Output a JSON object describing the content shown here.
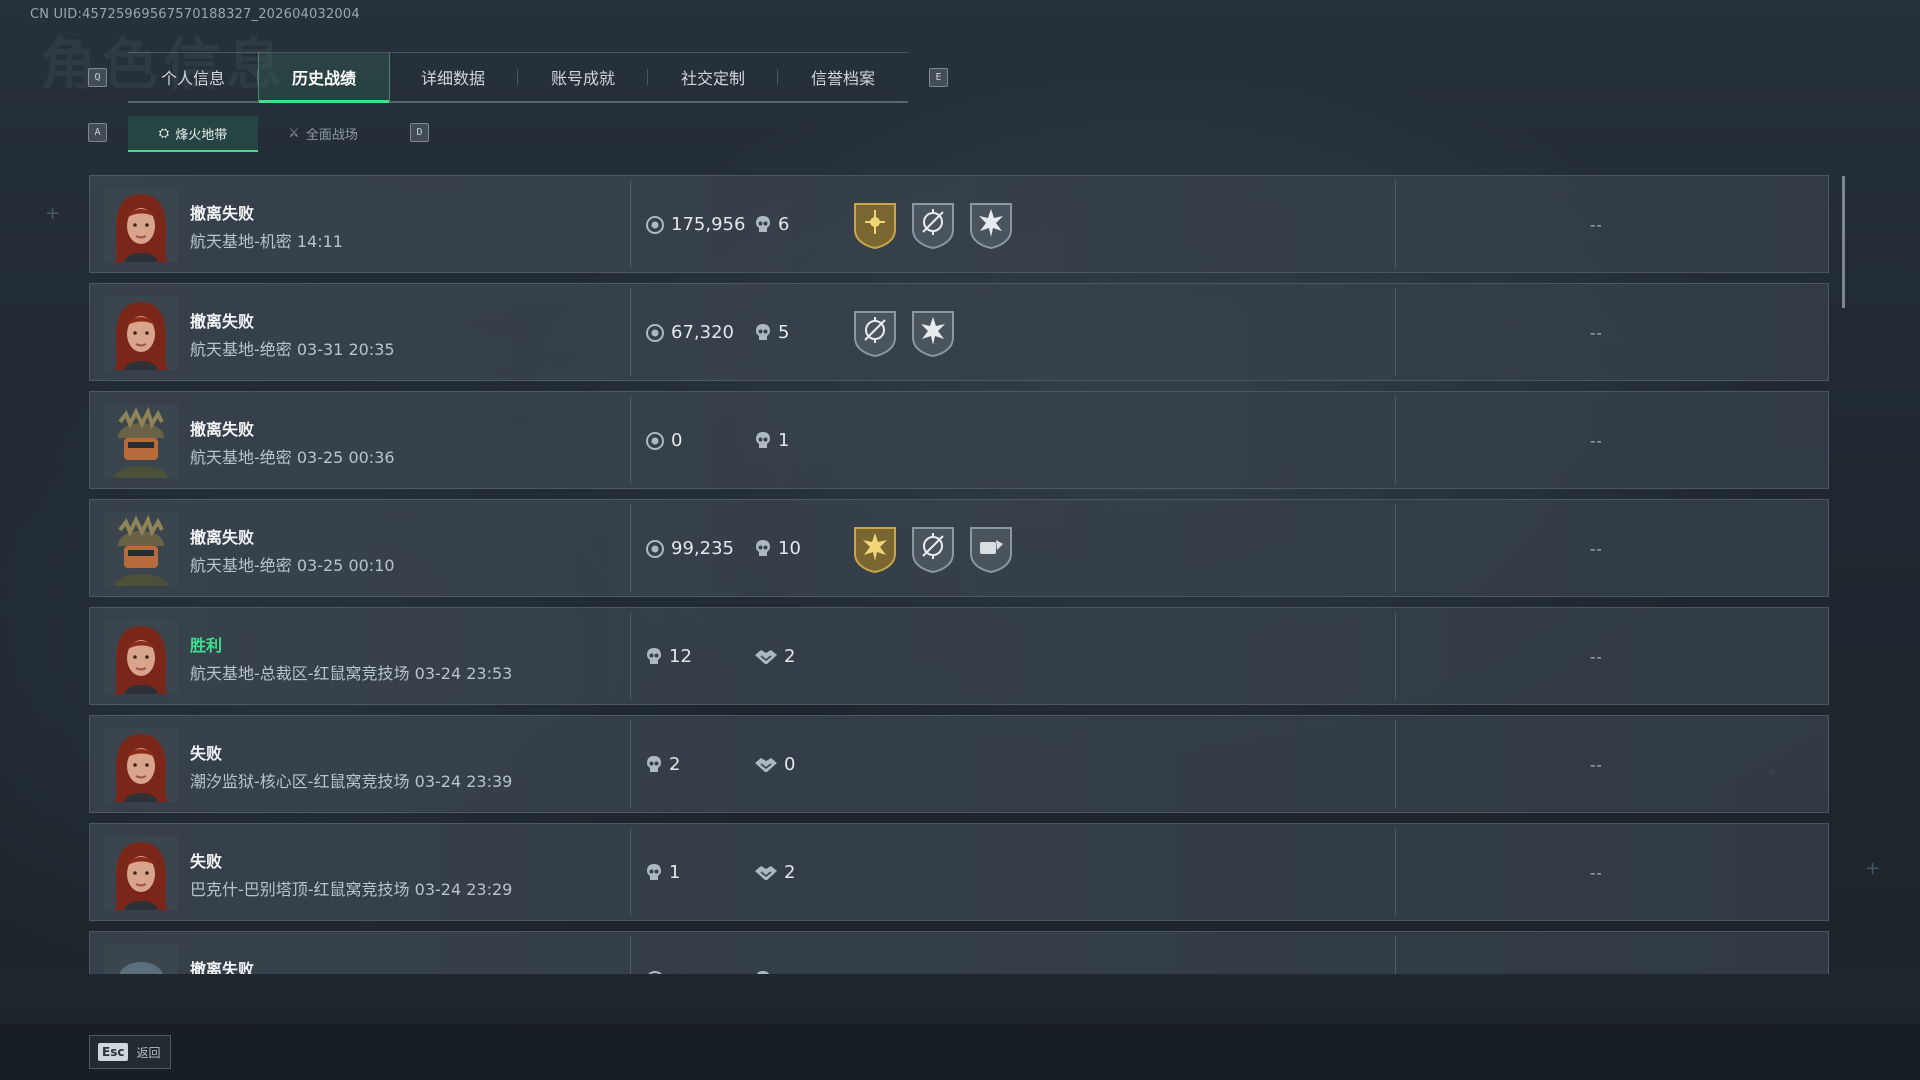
{
  "uid_text": "CN UID:4572596956757018832​7_202604032004",
  "ghost_title": "角色信息",
  "keys": {
    "prev_tab": "Q",
    "next_tab": "E",
    "prev_sub": "A",
    "next_sub": "D"
  },
  "tabs": [
    {
      "label": "个人信息",
      "active": false
    },
    {
      "label": "历史战绩",
      "active": true
    },
    {
      "label": "详细数据",
      "active": false
    },
    {
      "label": "账号成就",
      "active": false
    },
    {
      "label": "社交定制",
      "active": false
    },
    {
      "label": "信誉档案",
      "active": false
    }
  ],
  "subtabs": [
    {
      "label": "烽火地带",
      "active": true
    },
    {
      "label": "全面战场",
      "active": false
    }
  ],
  "rows": [
    {
      "avatar": "avatar-female-red-hair",
      "title": "撤离失败",
      "outcome": "loss",
      "detail": "航天基地-机密 14:11",
      "stat1_icon": "money-icon",
      "stat1": "175,956",
      "stat2_icon": "kill-icon",
      "stat2": "6",
      "badges": [
        "gold-emblem-icon",
        "crosshair-badge-icon",
        "star-burst-badge-icon"
      ],
      "right": "--"
    },
    {
      "avatar": "avatar-female-red-hair",
      "title": "撤离失败",
      "outcome": "loss",
      "detail": "航天基地-绝密 03-31 20:35",
      "stat1_icon": "money-icon",
      "stat1": "67,320",
      "stat2_icon": "kill-icon",
      "stat2": "5",
      "badges": [
        "crosshair-badge-icon",
        "star-burst-badge-icon"
      ],
      "right": "--"
    },
    {
      "avatar": "avatar-helmet-soldier",
      "title": "撤离失败",
      "outcome": "loss",
      "detail": "航天基地-绝密 03-25 00:36",
      "stat1_icon": "money-icon",
      "stat1": "0",
      "stat2_icon": "kill-icon",
      "stat2": "1",
      "badges": [],
      "right": "--"
    },
    {
      "avatar": "avatar-helmet-soldier",
      "title": "撤离失败",
      "outcome": "loss",
      "detail": "航天基地-绝密 03-25 00:10",
      "stat1_icon": "money-icon",
      "stat1": "99,235",
      "stat2_icon": "kill-icon",
      "stat2": "10",
      "badges": [
        "gold-star-burst-badge-icon",
        "crosshair-badge-icon",
        "loot-badge-icon"
      ],
      "right": "--"
    },
    {
      "avatar": "avatar-female-red-hair",
      "title": "胜利",
      "outcome": "win",
      "detail": "航天基地-总裁区-红鼠窝竞技场 03-24 23:53",
      "stat1_icon": "kill-icon",
      "stat1": "12",
      "stat2_icon": "assist-icon",
      "stat2": "2",
      "badges": [],
      "right": "--"
    },
    {
      "avatar": "avatar-female-red-hair",
      "title": "失败",
      "outcome": "loss",
      "detail": "潮汐监狱-核心区-红鼠窝竞技场 03-24 23:39",
      "stat1_icon": "kill-icon",
      "stat1": "2",
      "stat2_icon": "assist-icon",
      "stat2": "0",
      "badges": [],
      "right": "--"
    },
    {
      "avatar": "avatar-female-red-hair",
      "title": "失败",
      "outcome": "loss",
      "detail": "巴克什-巴别塔顶-红鼠窝竞技场 03-24 23:29",
      "stat1_icon": "kill-icon",
      "stat1": "1",
      "stat2_icon": "assist-icon",
      "stat2": "2",
      "badges": [],
      "right": "--"
    },
    {
      "avatar": "avatar-helmet-blue",
      "title": "撤离失败",
      "outcome": "loss",
      "detail": "",
      "stat1_icon": "money-icon",
      "stat1": "",
      "stat2_icon": "kill-icon",
      "stat2": "",
      "badges": [],
      "right": ""
    }
  ],
  "footer": {
    "esc_key": "Esc",
    "back_label": "返回"
  },
  "colors": {
    "accent": "#3ee08f",
    "row_bg": "#3a444e",
    "text": "#d6dde3"
  }
}
